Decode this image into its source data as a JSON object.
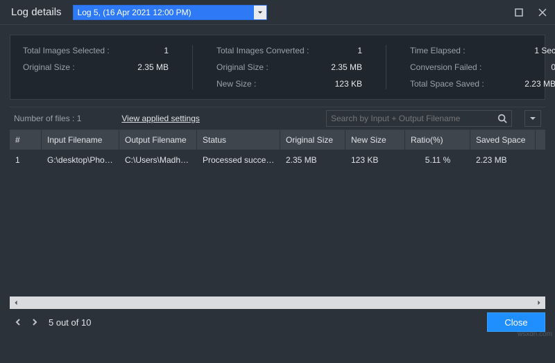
{
  "titlebar": {
    "title": "Log details",
    "selected_log": "Log 5, (16 Apr 2021 12:00 PM)"
  },
  "summary": {
    "g1": {
      "total_images_selected_label": "Total Images Selected :",
      "total_images_selected_value": "1",
      "original_size_label": "Original Size :",
      "original_size_value": "2.35 MB"
    },
    "g2": {
      "total_images_converted_label": "Total Images Converted :",
      "total_images_converted_value": "1",
      "original_size_label": "Original Size :",
      "original_size_value": "2.35 MB",
      "new_size_label": "New Size :",
      "new_size_value": "123 KB"
    },
    "g3": {
      "time_elapsed_label": "Time Elapsed :",
      "time_elapsed_value": "1 Sec",
      "conversion_failed_label": "Conversion Failed :",
      "conversion_failed_value": "0",
      "total_space_saved_label": "Total Space Saved :",
      "total_space_saved_value": "2.23 MB"
    }
  },
  "toolbar": {
    "files_count_label": "Number of files : 1",
    "applied_settings_link": "View applied settings",
    "search_placeholder": "Search by Input + Output Filename"
  },
  "table": {
    "headers": {
      "idx": "#",
      "input": "Input Filename",
      "output": "Output Filename",
      "status": "Status",
      "osize": "Original Size",
      "nsize": "New Size",
      "ratio": "Ratio(%)",
      "saved": "Saved Space"
    },
    "rows": [
      {
        "idx": "1",
        "input": "G:\\desktop\\Pho…",
        "output": "C:\\Users\\Madhuri…",
        "status": "Processed succes…",
        "osize": "2.35 MB",
        "nsize": "123 KB",
        "ratio": "5.11 %",
        "saved": "2.23 MB"
      }
    ]
  },
  "footer": {
    "pager": "5 out of 10",
    "close": "Close"
  },
  "watermark": "wsxdn.com"
}
